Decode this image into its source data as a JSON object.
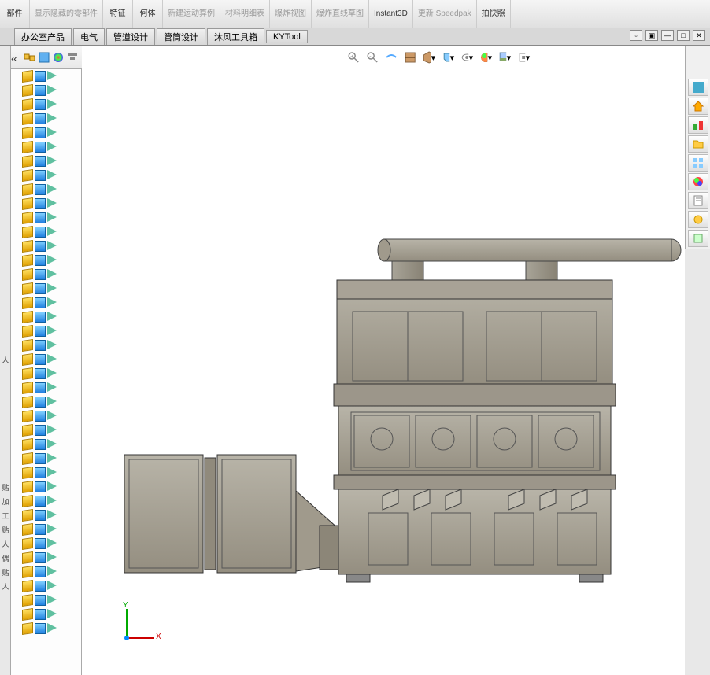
{
  "ribbon": {
    "items": [
      {
        "label": "部件",
        "disabled": false
      },
      {
        "label": "显示隐藏的零部件",
        "disabled": true
      },
      {
        "label": "特征",
        "disabled": false
      },
      {
        "label": "何体",
        "disabled": false
      },
      {
        "label": "新建运动算例",
        "disabled": true
      },
      {
        "label": "材料明细表",
        "disabled": true
      },
      {
        "label": "爆炸视图",
        "disabled": true
      },
      {
        "label": "爆炸直线草图",
        "disabled": true
      },
      {
        "label": "Instant3D",
        "disabled": false
      },
      {
        "label": "更新 Speedpak",
        "disabled": true
      },
      {
        "label": "拍快照",
        "disabled": false
      }
    ]
  },
  "tabs": [
    {
      "label": "办公室产品"
    },
    {
      "label": "电气"
    },
    {
      "label": "管道设计"
    },
    {
      "label": "管筒设计"
    },
    {
      "label": "沐风工具箱"
    },
    {
      "label": "KYTool"
    }
  ],
  "triad": {
    "x": "X",
    "y": "Y"
  },
  "left_markers": [
    "",
    "",
    "",
    "",
    "",
    "",
    "",
    "",
    "",
    "",
    "",
    "",
    "",
    "",
    "",
    "",
    "",
    "",
    "",
    "",
    "人",
    "",
    "",
    "",
    "",
    "",
    "",
    "",
    "",
    "贴",
    "加",
    "工",
    "贴",
    "人",
    "偶",
    "贴",
    "人",
    "",
    "",
    ""
  ]
}
